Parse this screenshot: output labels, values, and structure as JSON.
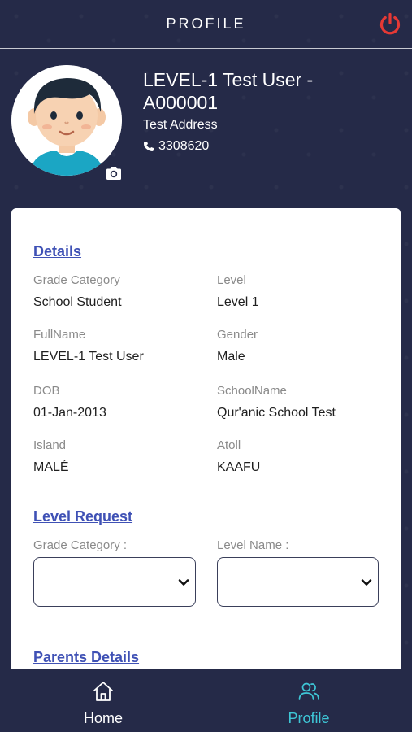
{
  "header": {
    "title": "PROFILE",
    "power_icon": "power-icon",
    "power_color": "#e53935"
  },
  "profile": {
    "name": "LEVEL-1 Test User - A000001",
    "address": "Test Address",
    "phone": "3308620",
    "avatar_icon": "boy-avatar",
    "camera_icon": "camera-icon"
  },
  "details": {
    "title": "Details",
    "fields": [
      {
        "label": "Grade Category",
        "value": "School Student"
      },
      {
        "label": "Level",
        "value": "Level 1"
      },
      {
        "label": "FullName",
        "value": "LEVEL-1 Test User"
      },
      {
        "label": "Gender",
        "value": "Male"
      },
      {
        "label": "DOB",
        "value": "01-Jan-2013"
      },
      {
        "label": "SchoolName",
        "value": "Qur'anic School Test"
      },
      {
        "label": "Island",
        "value": "MALÉ"
      },
      {
        "label": "Atoll",
        "value": "KAAFU"
      }
    ]
  },
  "level_request": {
    "title": "Level Request",
    "grade_category_label": "Grade Category :",
    "grade_category_value": "",
    "level_name_label": "Level Name :",
    "level_name_value": ""
  },
  "parents": {
    "title": "Parents Details"
  },
  "nav": {
    "items": [
      {
        "label": "Home",
        "icon": "home-icon"
      },
      {
        "label": "Profile",
        "icon": "people-icon"
      }
    ],
    "active_color": "#3ec6d6",
    "inactive_color": "#ffffff"
  },
  "colors": {
    "background": "#252a48",
    "link": "#3f51b5"
  }
}
